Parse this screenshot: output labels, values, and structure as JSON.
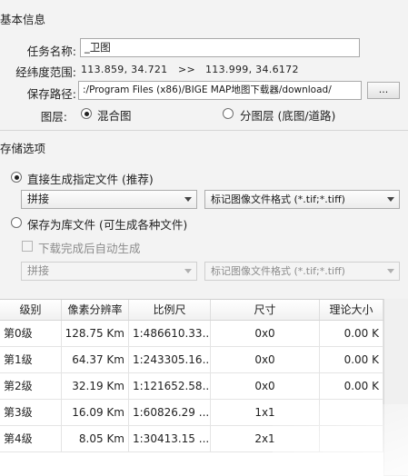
{
  "basic": {
    "section_title": "基本信息",
    "task_name_label": "任务名称:",
    "task_name_value": "_卫图",
    "latlon_label": "经纬度范围:",
    "latlon_from": "113.859, 34.721",
    "latlon_sep": ">>",
    "latlon_to": "113.999, 34.6172",
    "save_path_label": "保存路径:",
    "save_path_value": ":/Program Files (x86)/BIGE MAP地图下载器/download/",
    "browse_label": "...",
    "layer_label": "图层:",
    "layer_mixed": "混合图",
    "layer_split": "分图层 (底图/道路)"
  },
  "storage": {
    "section_title": "存储选项",
    "direct_label": "直接生成指定文件 (推荐)",
    "direct_mode": "拼接",
    "direct_format": "标记图像文件格式 (*.tif;*.tiff)",
    "library_label": "保存为库文件 (可生成各种文件)",
    "auto_label": "下载完成后自动生成",
    "library_mode": "拼接",
    "library_format": "标记图像文件格式 (*.tif;*.tiff)"
  },
  "table": {
    "headers": [
      "级别",
      "像素分辨率",
      "比例尺",
      "尺寸",
      "理论大小"
    ],
    "rows": [
      [
        "第0级",
        "128.75 Km",
        "1:486610.33...",
        "0x0",
        "0.00 K"
      ],
      [
        "第1级",
        "64.37 Km",
        "1:243305.16...",
        "0x0",
        "0.00 K"
      ],
      [
        "第2级",
        "32.19 Km",
        "1:121652.58...",
        "0x0",
        "0.00 K"
      ],
      [
        "第3级",
        "16.09 Km",
        "1:60826.29 ...",
        "1x1",
        ""
      ],
      [
        "第4级",
        "8.05 Km",
        "1:30413.15 ...",
        "2x1",
        ""
      ]
    ]
  },
  "icons": {
    "combo_arrow": "chevron-down-icon",
    "radio": "radio-button"
  }
}
